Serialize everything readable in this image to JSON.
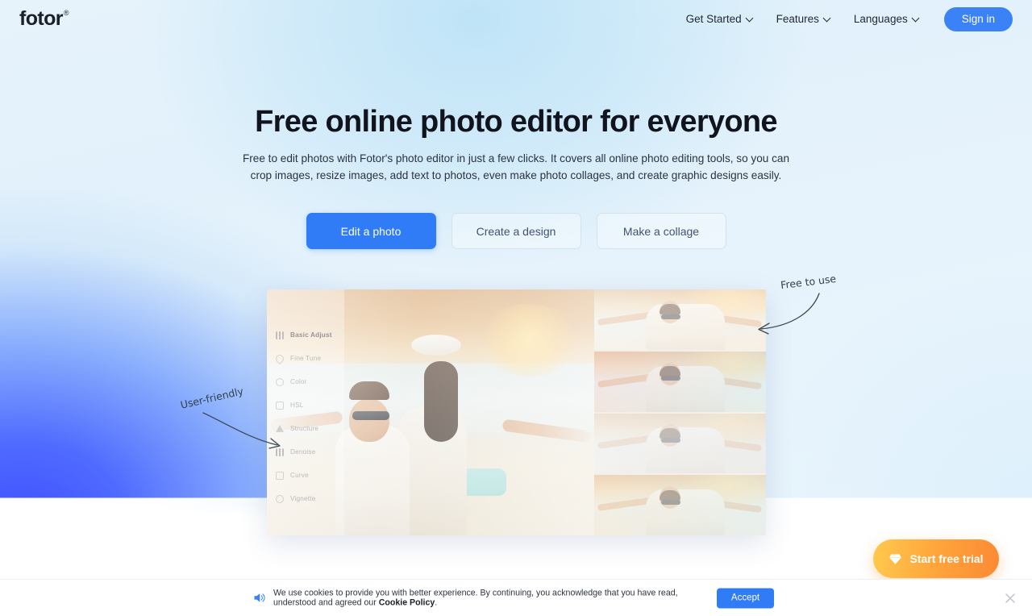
{
  "header": {
    "logo_text": "fotor",
    "logo_mark": "®",
    "nav": [
      {
        "label": "Get Started",
        "icon": "chevron-down-icon"
      },
      {
        "label": "Features",
        "icon": "chevron-down-icon"
      },
      {
        "label": "Languages",
        "icon": "chevron-down-icon"
      }
    ],
    "signin_label": "Sign in",
    "accent_color": "#3b82f6"
  },
  "hero": {
    "headline": "Free online photo editor for everyone",
    "subtext": "Free to edit photos with Fotor's photo editor in just a few clicks. It covers all online photo editing tools, so you can crop images, resize images, add text to photos, even make photo collages, and create graphic designs easily.",
    "cta": [
      {
        "label": "Edit a photo",
        "style": "primary"
      },
      {
        "label": "Create a design",
        "style": "outline"
      },
      {
        "label": "Make a collage",
        "style": "outline"
      }
    ],
    "annotations": [
      {
        "text": "User-friendly",
        "position": "left"
      },
      {
        "text": "Free to use",
        "position": "right"
      }
    ],
    "gradient_from": "#4f6bff",
    "gradient_to": "#e6f3fb"
  },
  "editor_preview": {
    "tools": [
      {
        "label": "Basic Adjust",
        "icon": "sliders-icon",
        "active": true
      },
      {
        "label": "Fine Tune",
        "icon": "droplet-icon",
        "active": false
      },
      {
        "label": "Color",
        "icon": "palette-icon",
        "active": false
      },
      {
        "label": "HSL",
        "icon": "hsl-icon",
        "active": false
      },
      {
        "label": "Structure",
        "icon": "triangle-icon",
        "active": false
      },
      {
        "label": "Denoise",
        "icon": "bars-icon",
        "active": false
      },
      {
        "label": "Curve",
        "icon": "curve-icon",
        "active": false
      },
      {
        "label": "Vignette",
        "icon": "vignette-icon",
        "active": false
      }
    ],
    "filter_thumbnails": [
      {
        "name": "filter-preview-1"
      },
      {
        "name": "filter-preview-2"
      },
      {
        "name": "filter-preview-3"
      },
      {
        "name": "filter-preview-4"
      }
    ]
  },
  "trial_button": {
    "label": "Start free trial",
    "icon": "diamond-icon",
    "gradient_from": "#ffc94d",
    "gradient_to": "#fb8a34"
  },
  "cookie_bar": {
    "icon": "speaker-icon",
    "text_before": "We use cookies to provide you with better experience. By continuing, you acknowledge that you have read, understood and agreed our ",
    "policy_link": "Cookie Policy",
    "text_after": ".",
    "accept_label": "Accept",
    "close_icon": "close-icon"
  }
}
